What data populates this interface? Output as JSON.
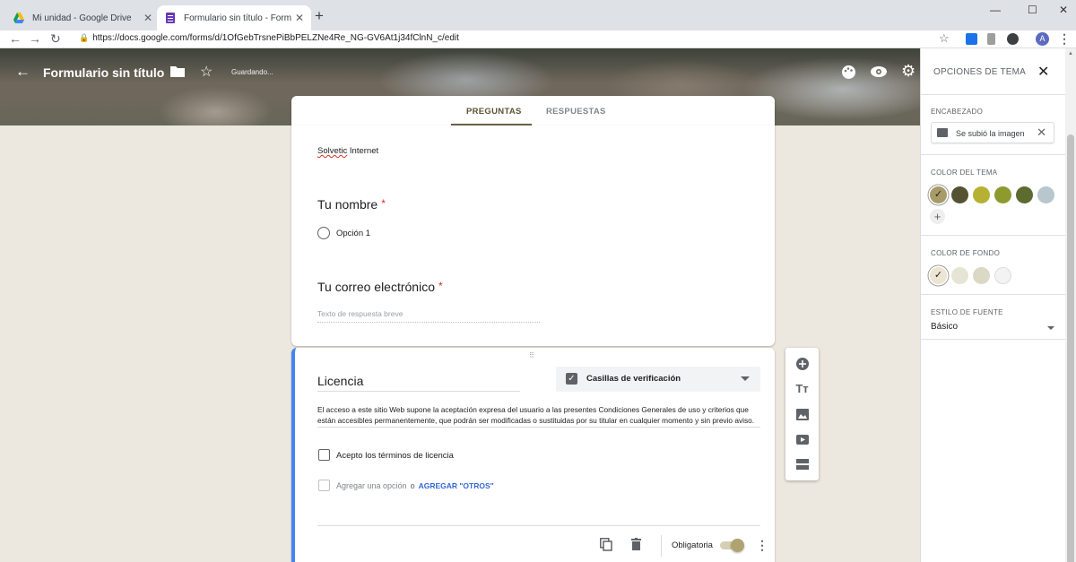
{
  "browser": {
    "tabs": [
      {
        "title": "Mi unidad - Google Drive",
        "active": false
      },
      {
        "title": "Formulario sin título - Formulario",
        "active": true
      }
    ],
    "url": "https://docs.google.com/forms/d/1OfGebTrsnePiBbPELZNe4Re_NG-GV6At1j34fClnN_c/edit",
    "profile_initial": "A"
  },
  "header": {
    "title": "Formulario sin título",
    "status": "Guardando..."
  },
  "form_tabs": [
    "PREGUNTAS",
    "RESPUESTAS"
  ],
  "form": {
    "description": "Solvetic Internet",
    "description_misspelled": "Solvetic",
    "description_rest": " Internet",
    "q1": {
      "title": "Tu nombre",
      "required_mark": "*",
      "option": "Opción 1"
    },
    "q2": {
      "title": "Tu correo electrónico",
      "required_mark": "*",
      "placeholder": "Texto de respuesta breve"
    },
    "active_question": {
      "title": "Licencia",
      "type": "Casillas de verificación",
      "description": "El acceso a este sitio Web supone la aceptación expresa del usuario a las presentes Condiciones Generales de uso y criterios que están accesibles permanentemente, que podrán ser modificadas o sustituidas por su titular en cualquier momento y sin previo aviso.",
      "option": "Acepto los términos de licencia",
      "add_option": "Agregar una opción",
      "or": "o",
      "add_other": "AGREGAR \"OTROS\"",
      "required_label": "Obligatoria",
      "required_on": true
    }
  },
  "panel": {
    "title": "OPCIONES DE TEMA",
    "header_section": "ENCABEZADO",
    "image_label": "Se subió la imagen",
    "theme_color_section": "COLOR DEL TEMA",
    "theme_colors": [
      "#a89b67",
      "#555233",
      "#b6b133",
      "#8c9a2e",
      "#5d6a30",
      "#b8c6ce"
    ],
    "theme_selected": 0,
    "bg_color_section": "COLOR DE FONDO",
    "bg_colors": [
      "#ede5d1",
      "#e6e4d4",
      "#dcd8c6",
      "#f3f3f3"
    ],
    "bg_selected": 0,
    "font_section": "ESTILO DE FUENTE",
    "font_value": "Básico"
  }
}
